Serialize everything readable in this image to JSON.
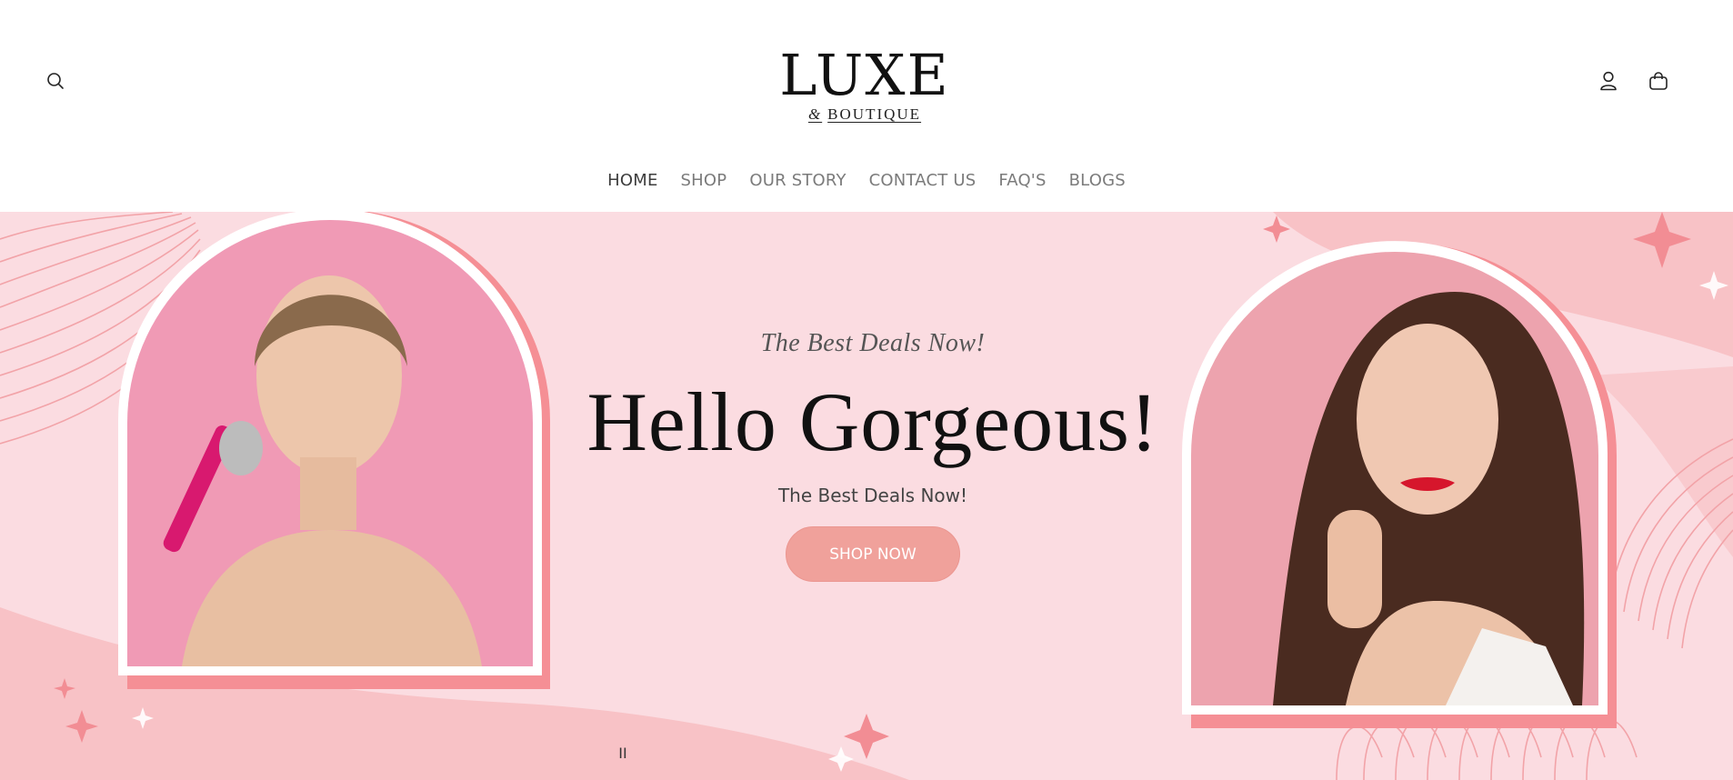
{
  "header": {
    "logo": {
      "main": "LUXE",
      "sub_amp": "&",
      "sub": "BOUTIQUE"
    },
    "icons": {
      "search": "search-icon",
      "account": "user-icon",
      "cart": "shopping-bag-icon"
    }
  },
  "nav": {
    "items": [
      {
        "label": "HOME",
        "active": true
      },
      {
        "label": "SHOP"
      },
      {
        "label": "OUR STORY"
      },
      {
        "label": "CONTACT US"
      },
      {
        "label": "FAQ'S"
      },
      {
        "label": "BLOGS"
      }
    ]
  },
  "hero": {
    "eyebrow": "The Best Deals Now!",
    "headline": "Hello Gorgeous!",
    "subtext": "The Best Deals Now!",
    "cta_label": "SHOP NOW",
    "pause_label": "II"
  },
  "colors": {
    "hero_bg": "#fbdce1",
    "accent_pink": "#f0a19b",
    "wave_pink": "#f7b9bd",
    "frame_shadow": "#f58f95"
  }
}
